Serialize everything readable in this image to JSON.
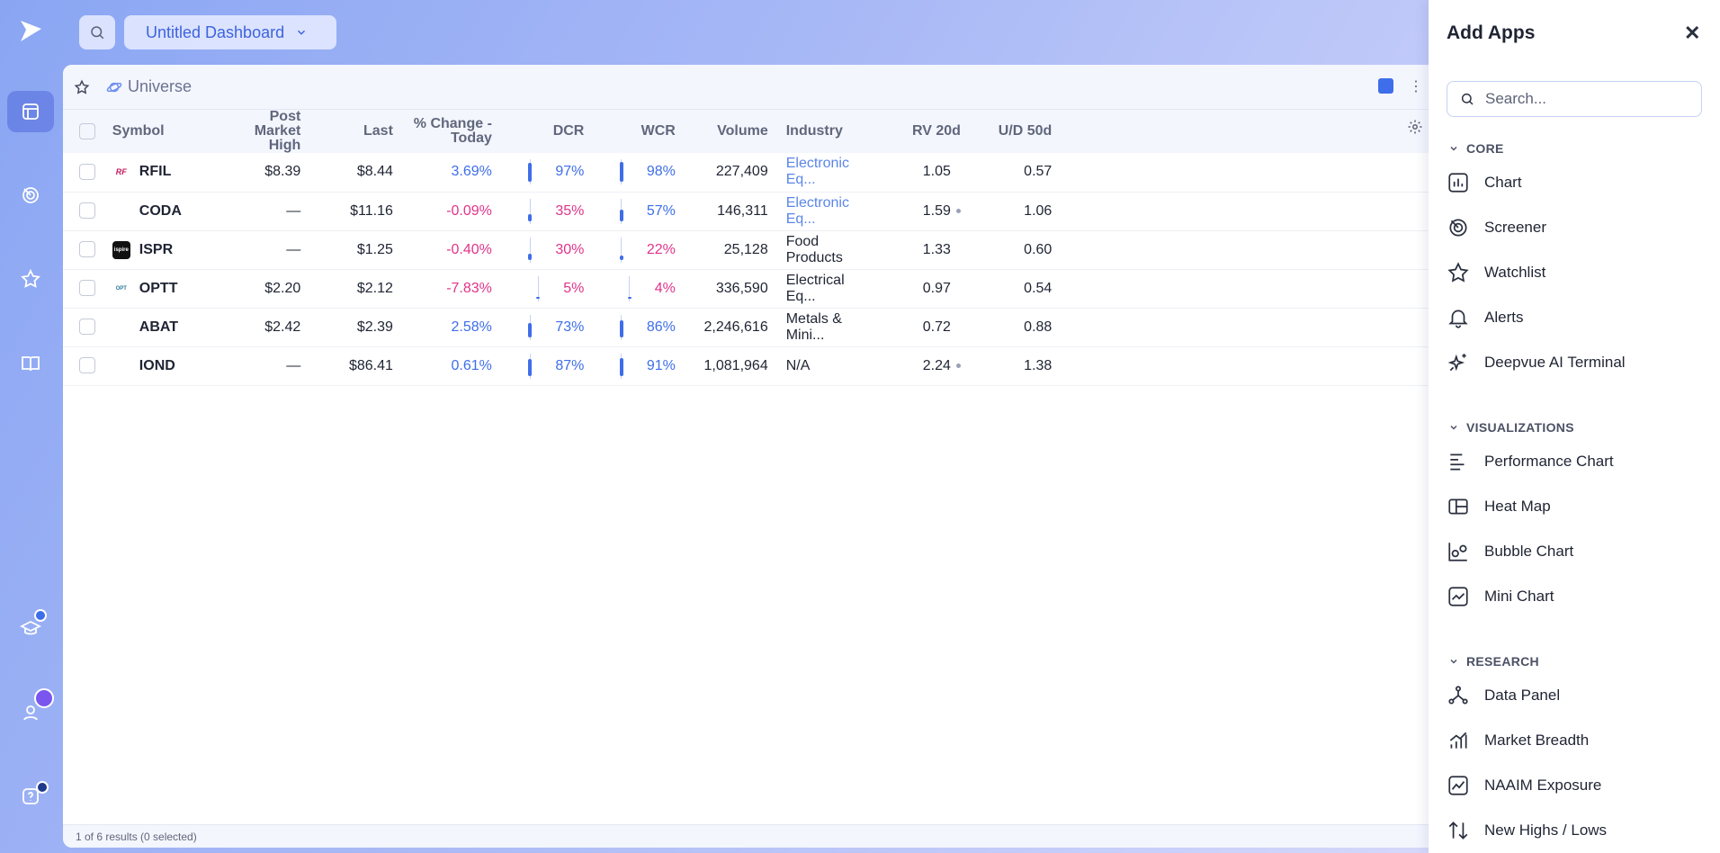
{
  "topbar": {
    "dashboard_title": "Untitled Dashboard"
  },
  "panel": {
    "universe_label": "Universe",
    "columns": [
      "Symbol",
      "Post Market High",
      "Last",
      "% Change - Today",
      "DCR",
      "WCR",
      "Volume",
      "Industry",
      "RV 20d",
      "U/D 50d"
    ],
    "rows": [
      {
        "symbol": "RFIL",
        "logo_text": "RF",
        "post_high": "$8.39",
        "last": "$8.44",
        "change": "3.69%",
        "change_dir": "pos",
        "dcr": "97%",
        "dcr_dir": "pos",
        "dcr_level": 0.97,
        "wcr": "98%",
        "wcr_dir": "pos",
        "wcr_level": 0.98,
        "volume": "227,409",
        "industry": "Electronic Eq...",
        "industry_link": true,
        "rv20": "1.05",
        "rv_dot": false,
        "ud50": "0.57"
      },
      {
        "symbol": "CODA",
        "logo_text": "",
        "post_high": "—",
        "last": "$11.16",
        "change": "-0.09%",
        "change_dir": "neg",
        "dcr": "35%",
        "dcr_dir": "neg",
        "dcr_level": 0.35,
        "wcr": "57%",
        "wcr_dir": "pos",
        "wcr_level": 0.57,
        "volume": "146,311",
        "industry": "Electronic Eq...",
        "industry_link": true,
        "rv20": "1.59",
        "rv_dot": true,
        "ud50": "1.06"
      },
      {
        "symbol": "ISPR",
        "logo_text": "ispire",
        "post_high": "—",
        "last": "$1.25",
        "change": "-0.40%",
        "change_dir": "neg",
        "dcr": "30%",
        "dcr_dir": "neg",
        "dcr_level": 0.3,
        "wcr": "22%",
        "wcr_dir": "neg",
        "wcr_level": 0.22,
        "volume": "25,128",
        "industry": "Food Products",
        "industry_link": false,
        "rv20": "1.33",
        "rv_dot": false,
        "ud50": "0.60"
      },
      {
        "symbol": "OPTT",
        "logo_text": "OPT",
        "post_high": "$2.20",
        "last": "$2.12",
        "change": "-7.83%",
        "change_dir": "neg",
        "dcr": "5%",
        "dcr_dir": "neg",
        "dcr_level": 0.05,
        "wcr": "4%",
        "wcr_dir": "neg",
        "wcr_level": 0.04,
        "volume": "336,590",
        "industry": "Electrical Eq...",
        "industry_link": false,
        "rv20": "0.97",
        "rv_dot": false,
        "ud50": "0.54"
      },
      {
        "symbol": "ABAT",
        "logo_text": "",
        "post_high": "$2.42",
        "last": "$2.39",
        "change": "2.58%",
        "change_dir": "pos",
        "dcr": "73%",
        "dcr_dir": "pos",
        "dcr_level": 0.73,
        "wcr": "86%",
        "wcr_dir": "pos",
        "wcr_level": 0.86,
        "volume": "2,246,616",
        "industry": "Metals & Mini...",
        "industry_link": false,
        "rv20": "0.72",
        "rv_dot": false,
        "ud50": "0.88"
      },
      {
        "symbol": "IOND",
        "logo_text": "",
        "post_high": "—",
        "last": "$86.41",
        "change": "0.61%",
        "change_dir": "pos",
        "dcr": "87%",
        "dcr_dir": "pos",
        "dcr_level": 0.87,
        "wcr": "91%",
        "wcr_dir": "pos",
        "wcr_level": 0.91,
        "volume": "1,081,964",
        "industry": "N/A",
        "industry_link": false,
        "rv20": "2.24",
        "rv_dot": true,
        "ud50": "1.38"
      }
    ],
    "footer": "1 of 6 results (0 selected)"
  },
  "drawer": {
    "title": "Add Apps",
    "search_placeholder": "Search...",
    "sections": [
      {
        "label": "CORE",
        "items": [
          {
            "label": "Chart",
            "icon": "chart-icon"
          },
          {
            "label": "Screener",
            "icon": "screener-icon"
          },
          {
            "label": "Watchlist",
            "icon": "star-icon"
          },
          {
            "label": "Alerts",
            "icon": "bell-icon"
          },
          {
            "label": "Deepvue AI Terminal",
            "icon": "sparkle-icon"
          }
        ]
      },
      {
        "label": "VISUALIZATIONS",
        "items": [
          {
            "label": "Performance Chart",
            "icon": "performance-icon"
          },
          {
            "label": "Heat Map",
            "icon": "heatmap-icon"
          },
          {
            "label": "Bubble Chart",
            "icon": "bubble-icon"
          },
          {
            "label": "Mini Chart",
            "icon": "minichart-icon"
          }
        ]
      },
      {
        "label": "RESEARCH",
        "items": [
          {
            "label": "Data Panel",
            "icon": "data-panel-icon"
          },
          {
            "label": "Market Breadth",
            "icon": "breadth-icon"
          },
          {
            "label": "NAAIM Exposure",
            "icon": "naaim-icon"
          },
          {
            "label": "New Highs / Lows",
            "icon": "highs-lows-icon"
          }
        ]
      }
    ]
  },
  "colors": {
    "accent": "#3e6ee9",
    "negative": "#e0348a",
    "link": "#5a86e8"
  }
}
